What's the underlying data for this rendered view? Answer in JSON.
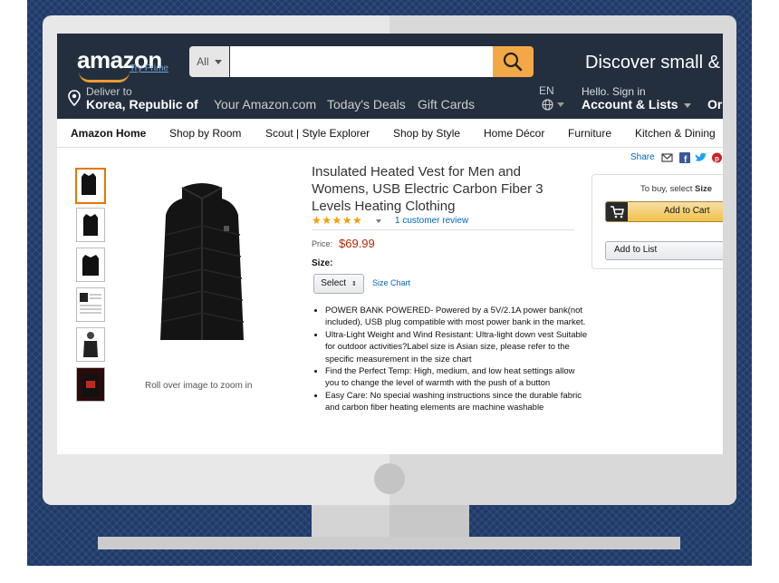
{
  "header": {
    "logo_text": "amazon",
    "try_prime": "Try Prime",
    "search_category": "All",
    "search_placeholder": "",
    "discover": "Discover small &",
    "deliver_label": "Deliver to",
    "deliver_country": "Korea, Republic of",
    "nav_links": [
      "Your Amazon.com",
      "Today's Deals",
      "Gift Cards"
    ],
    "language": "EN",
    "hello": "Hello. Sign in",
    "account": "Account & Lists",
    "orders_partial": "Or"
  },
  "subnav": {
    "items": [
      "Amazon Home",
      "Shop by Room",
      "Scout | Style Explorer",
      "Shop by Style",
      "Home Décor",
      "Furniture",
      "Kitchen & Dining"
    ]
  },
  "product": {
    "title": "Insulated Heated Vest for Men and Womens, USB Electric Carbon Fiber 3 Levels Heating Clothing",
    "rating_stars": "★★★★★",
    "rating": 5,
    "reviews": "1 customer review",
    "price_label": "Price:",
    "price": "$69.99",
    "size_label": "Size:",
    "size_select": "Select",
    "size_chart": "Size Chart",
    "zoom_hint": "Roll over image to zoom in",
    "thumbnail_count": 6,
    "bullets": [
      "POWER BANK POWERED- Powered by a 5V/2.1A power bank(not included), USB plug compatible with most power bank in the market.",
      "Ultra-Light Weight and Wind Resistant: Ultra-light down vest Suitable for outdoor activities?Label size is Asian size, please refer to the specific measurement in the size chart",
      "Find the Perfect Temp: High, medium, and low heat settings allow you to change the level of warmth with the push of a button",
      "Easy Care: No special washing instructions since the durable fabric and carbon fiber heating elements are machine washable"
    ]
  },
  "buybox": {
    "share": "Share",
    "to_buy_prefix": "To buy, select ",
    "to_buy_bold": "Size",
    "add_to_cart": "Add to Cart",
    "add_to_list": "Add to List"
  },
  "colors": {
    "header_bg": "#232f3e",
    "search_button": "#f3a847",
    "price": "#b12704",
    "link": "#0066c0",
    "backdrop": "#1f3a69"
  }
}
